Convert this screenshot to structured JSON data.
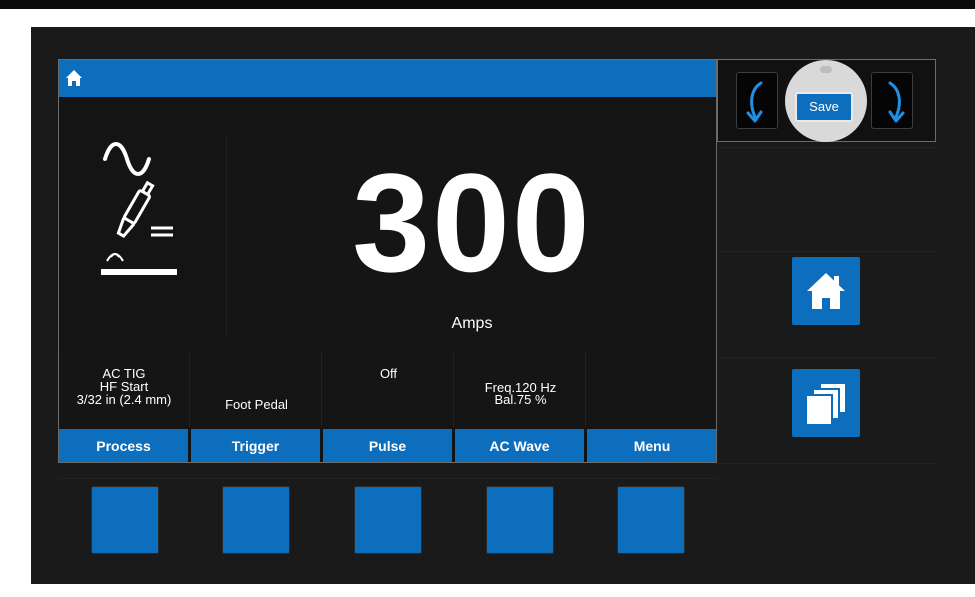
{
  "display": {
    "value": "300",
    "unit": "Amps"
  },
  "status": {
    "process": [
      "AC TIG",
      "HF Start",
      "3/32 in (2.4 mm)"
    ],
    "trigger": "Foot Pedal",
    "pulse": "Off",
    "ac_wave": [
      "Freq.120 Hz",
      "Bal.75 %"
    ],
    "menu": ""
  },
  "tabs": [
    "Process",
    "Trigger",
    "Pulse",
    "AC Wave",
    "Menu"
  ],
  "controls": {
    "save_label": "Save"
  },
  "icons": {
    "header_home": "home-icon",
    "process": "ac-tig-torch-icon",
    "nav_left": "rotate-left-arrow-icon",
    "nav_right": "rotate-right-arrow-icon",
    "side_home": "home-icon",
    "side_pages": "pages-stack-icon"
  },
  "colors": {
    "accent": "#0d6ebd",
    "background": "#1a1a1a",
    "text": "#ffffff"
  }
}
